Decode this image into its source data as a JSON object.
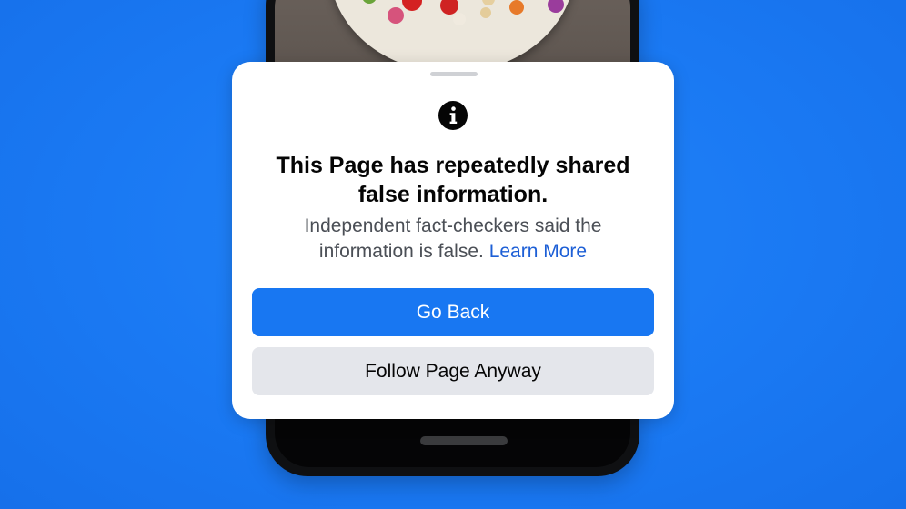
{
  "dialog": {
    "title": "This Page has repeatedly shared false information.",
    "subtitle": "Independent fact-checkers said the information is false.",
    "learn_more": "Learn More",
    "primary_button": "Go Back",
    "secondary_button": "Follow Page Anyway",
    "icon": "info-icon"
  },
  "colors": {
    "background": "#1877f2",
    "primary_button": "#1877f2",
    "secondary_button": "#e4e6eb",
    "link": "#1d5fd6"
  }
}
